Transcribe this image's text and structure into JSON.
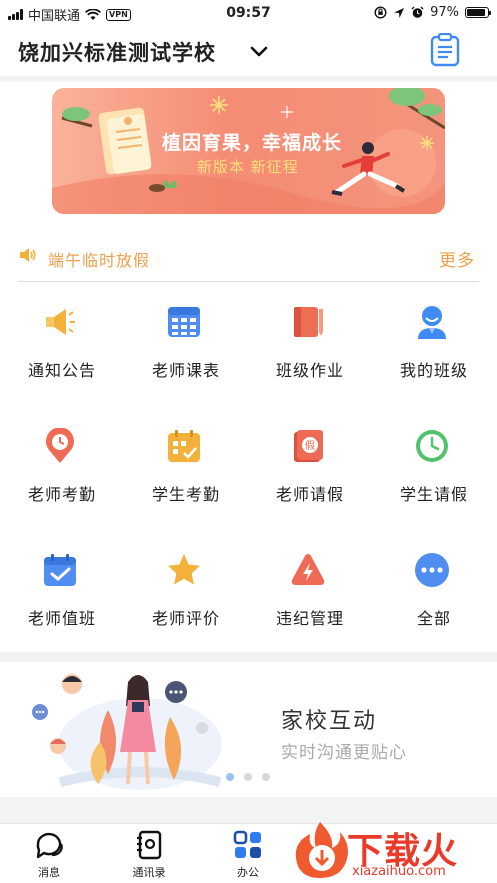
{
  "status": {
    "carrier": "中国联通",
    "vpn": "VPN",
    "time": "09:57",
    "battery": "97%",
    "battery_level": 0.97
  },
  "header": {
    "title": "饶加兴标准测试学校"
  },
  "banner": {
    "title": "植因育果，幸福成长",
    "subtitle": "新版本  新征程"
  },
  "notice": {
    "text": "端午临时放假",
    "more": "更多"
  },
  "features": [
    {
      "label": "通知公告",
      "icon": "megaphone-icon",
      "color": "#f3b13c"
    },
    {
      "label": "老师课表",
      "icon": "timetable-icon",
      "color": "#4f8ef0"
    },
    {
      "label": "班级作业",
      "icon": "homework-icon",
      "color": "#ee6e55"
    },
    {
      "label": "我的班级",
      "icon": "class-user-icon",
      "color": "#3f8bf2"
    },
    {
      "label": "老师考勤",
      "icon": "location-clock-icon",
      "color": "#ee6a55"
    },
    {
      "label": "学生考勤",
      "icon": "calendar-check-icon",
      "color": "#f3b13c"
    },
    {
      "label": "老师请假",
      "icon": "leave-form-icon",
      "color": "#ee6a55"
    },
    {
      "label": "学生请假",
      "icon": "clock-icon",
      "color": "#4fc26a"
    },
    {
      "label": "老师值班",
      "icon": "duty-calendar-icon",
      "color": "#4f8ef0"
    },
    {
      "label": "老师评价",
      "icon": "star-icon",
      "color": "#f3b13c"
    },
    {
      "label": "违纪管理",
      "icon": "warning-bolt-icon",
      "color": "#ee6a55"
    },
    {
      "label": "全部",
      "icon": "more-dots-icon",
      "color": "#4f8ef0"
    }
  ],
  "promo": {
    "title": "家校互动",
    "subtitle": "实时沟通更贴心",
    "active_dot": 0
  },
  "tabs": [
    {
      "label": "消息",
      "icon": "chat-icon"
    },
    {
      "label": "通讯录",
      "icon": "contacts-icon"
    },
    {
      "label": "办公",
      "icon": "apps-grid-icon"
    }
  ],
  "watermark": {
    "text": "下载火",
    "url": "xiazaihuo.com"
  }
}
